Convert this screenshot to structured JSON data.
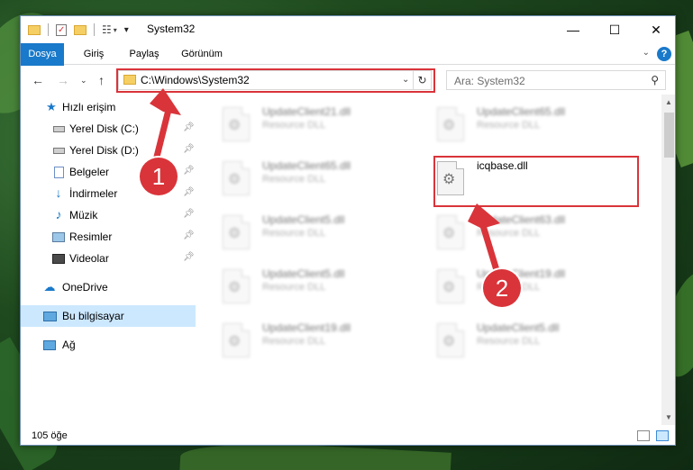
{
  "window": {
    "title": "System32",
    "controls": {
      "minimize": "—",
      "maximize": "☐",
      "close": "✕"
    }
  },
  "ribbon": {
    "tabs": [
      {
        "label": "Dosya",
        "active": true
      },
      {
        "label": "Giriş"
      },
      {
        "label": "Paylaş"
      },
      {
        "label": "Görünüm"
      }
    ],
    "help": "?"
  },
  "address": {
    "path": "C:\\Windows\\System32",
    "search_placeholder": "Ara: System32"
  },
  "sidebar": {
    "items": [
      {
        "label": "Hızlı erişim",
        "icon": "star-icon",
        "pinned": false
      },
      {
        "label": "Yerel Disk (C:)",
        "icon": "drive-icon",
        "pinned": true
      },
      {
        "label": "Yerel Disk (D:)",
        "icon": "drive-icon",
        "pinned": true
      },
      {
        "label": "Belgeler",
        "icon": "documents-icon",
        "pinned": true
      },
      {
        "label": "İndirmeler",
        "icon": "download-icon",
        "pinned": true
      },
      {
        "label": "Müzik",
        "icon": "music-icon",
        "pinned": true
      },
      {
        "label": "Resimler",
        "icon": "pictures-icon",
        "pinned": true
      },
      {
        "label": "Videolar",
        "icon": "videos-icon",
        "pinned": true
      },
      {
        "label": "OneDrive",
        "icon": "cloud-icon",
        "pinned": false
      },
      {
        "label": "Bu bilgisayar",
        "icon": "computer-icon",
        "pinned": false,
        "selected": true
      },
      {
        "label": "Ağ",
        "icon": "network-icon",
        "pinned": false
      }
    ]
  },
  "files": [
    {
      "name": "UpdateClient21.dll",
      "type": "Resource DLL"
    },
    {
      "name": "UpdateClient65.dll",
      "type": "Resource DLL"
    },
    {
      "name": "UpdateClient65.dll",
      "type": "Resource DLL"
    },
    {
      "name": "icqbase.dll",
      "type": ""
    },
    {
      "name": "UpdateClient5.dll",
      "type": "Resource DLL"
    },
    {
      "name": "UpdateClient63.dll",
      "type": "Resource DLL"
    },
    {
      "name": "UpdateClient5.dll",
      "type": "Resource DLL"
    },
    {
      "name": "UpdateClient19.dll",
      "type": "Resource DLL"
    },
    {
      "name": "UpdateClient19.dll",
      "type": "Resource DLL"
    },
    {
      "name": "UpdateClient5.dll",
      "type": "Resource DLL"
    }
  ],
  "status": {
    "count_text": "105 öğe"
  },
  "annotations": {
    "step1": "1",
    "step2": "2"
  },
  "colors": {
    "accent": "#1979ca",
    "highlight": "#d9343a",
    "selected": "#cce8ff"
  }
}
